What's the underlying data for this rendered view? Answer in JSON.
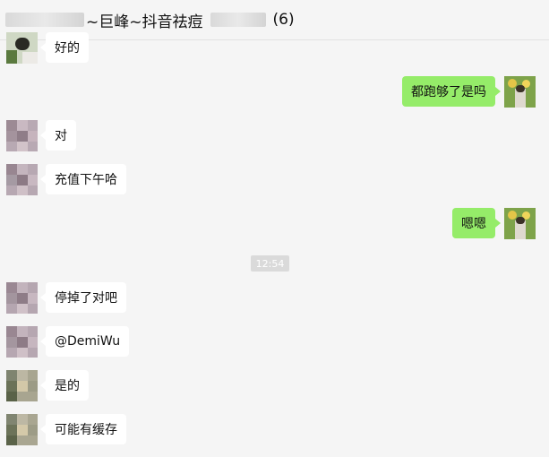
{
  "header": {
    "title_left": "~巨峰~抖音祛痘",
    "title_count": "(6)"
  },
  "messages": [
    {
      "side": "left",
      "text": "好的"
    },
    {
      "side": "right",
      "text": "都跑够了是吗"
    },
    {
      "side": "left",
      "text": "对"
    },
    {
      "side": "left",
      "text": "充值下午哈"
    },
    {
      "side": "right",
      "text": "嗯嗯"
    },
    {
      "side": "left",
      "text": "停掉了对吧"
    },
    {
      "side": "left",
      "text": "@DemiWu"
    },
    {
      "side": "left",
      "text": "是的"
    },
    {
      "side": "left",
      "text": "可能有缓存"
    }
  ],
  "timestamp": "12:54",
  "colors": {
    "sent_bubble": "#95ec69",
    "received_bubble": "#ffffff",
    "background": "#f5f5f5"
  }
}
